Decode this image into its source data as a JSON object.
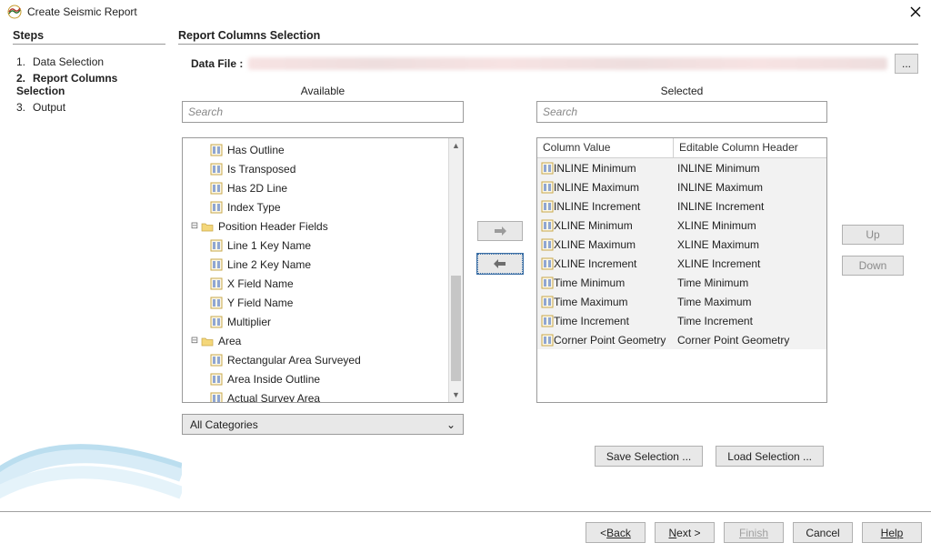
{
  "window": {
    "title": "Create Seismic Report"
  },
  "steps": {
    "heading": "Steps",
    "items": [
      {
        "num": "1.",
        "label": "Data Selection",
        "current": false
      },
      {
        "num": "2.",
        "label": "Report Columns Selection",
        "current": true
      },
      {
        "num": "3.",
        "label": "Output",
        "current": false
      }
    ]
  },
  "content": {
    "heading": "Report Columns Selection",
    "data_file_label": "Data File :",
    "browse_dots": "...",
    "available_heading": "Available",
    "selected_heading": "Selected",
    "search_placeholder": "Search",
    "category_select": "All Categories",
    "tree": [
      {
        "label": "Has Outline",
        "type": "col",
        "indent": 2
      },
      {
        "label": "Is Transposed",
        "type": "col",
        "indent": 2
      },
      {
        "label": "Has 2D Line",
        "type": "col",
        "indent": 2
      },
      {
        "label": "Index Type",
        "type": "col",
        "indent": 2
      },
      {
        "label": "Position Header Fields",
        "type": "folder",
        "indent": 1,
        "exp": "-"
      },
      {
        "label": "Line 1 Key Name",
        "type": "col",
        "indent": 2
      },
      {
        "label": "Line 2 Key Name",
        "type": "col",
        "indent": 2
      },
      {
        "label": "X Field Name",
        "type": "col",
        "indent": 2
      },
      {
        "label": "Y Field Name",
        "type": "col",
        "indent": 2
      },
      {
        "label": "Multiplier",
        "type": "col",
        "indent": 2
      },
      {
        "label": "Area",
        "type": "folder",
        "indent": 1,
        "exp": "-"
      },
      {
        "label": "Rectangular Area Surveyed",
        "type": "col",
        "indent": 2
      },
      {
        "label": "Area Inside Outline",
        "type": "col",
        "indent": 2
      },
      {
        "label": "Actual Survey Area",
        "type": "col",
        "indent": 2
      }
    ],
    "selected_headers": {
      "c1": "Column Value",
      "c2": "Editable Column Header"
    },
    "selected_rows": [
      {
        "value": "INLINE Minimum",
        "header": "INLINE Minimum"
      },
      {
        "value": "INLINE Maximum",
        "header": "INLINE Maximum"
      },
      {
        "value": "INLINE Increment",
        "header": "INLINE Increment"
      },
      {
        "value": "XLINE Minimum",
        "header": "XLINE Minimum"
      },
      {
        "value": "XLINE Maximum",
        "header": "XLINE Maximum"
      },
      {
        "value": "XLINE Increment",
        "header": "XLINE Increment"
      },
      {
        "value": "Time Minimum",
        "header": "Time Minimum"
      },
      {
        "value": "Time Maximum",
        "header": "Time Maximum"
      },
      {
        "value": "Time Increment",
        "header": "Time Increment"
      },
      {
        "value": "Corner Point Geometry",
        "header": "Corner Point Geometry"
      }
    ],
    "actions": {
      "save": "Save Selection ...",
      "load": "Load Selection ..."
    }
  },
  "transfer": {
    "right": "→",
    "left": "←"
  },
  "sidebtns": {
    "up": "Up",
    "down": "Down"
  },
  "footer": {
    "back": "Back",
    "next": "Next >",
    "finish": "Finish",
    "cancel": "Cancel",
    "help": "Help"
  }
}
